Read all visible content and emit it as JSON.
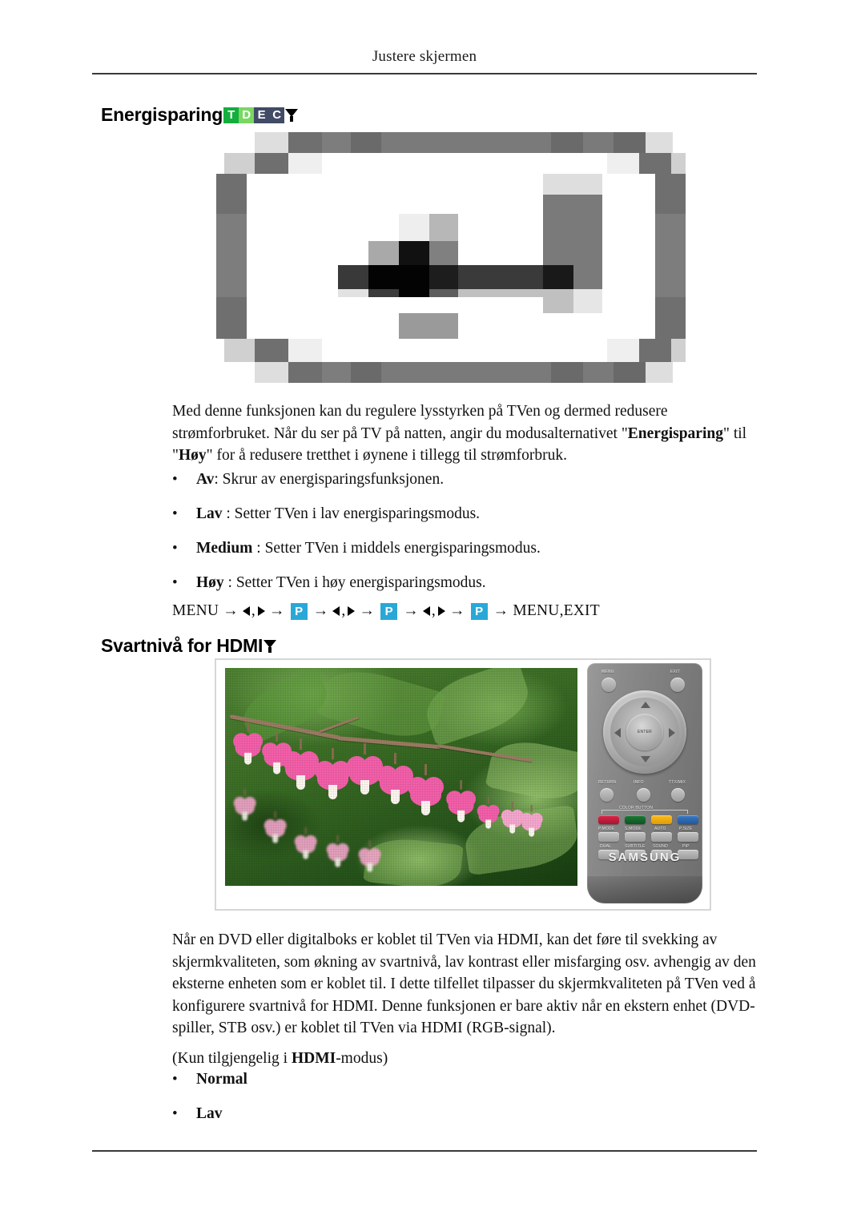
{
  "header": {
    "running_title": "Justere skjermen"
  },
  "sections": {
    "energisparing": {
      "heading": "Energisparing",
      "badges": [
        {
          "letter": "T",
          "color": "#14ae3c"
        },
        {
          "letter": "D",
          "color": "#79d763"
        },
        {
          "letter": "E",
          "color": "#414b66"
        },
        {
          "letter": "C",
          "color": "#414b66"
        }
      ],
      "filter_icon": "funnel-icon",
      "figure_alt": "energisparing-osd-screenshot",
      "paragraph_1": "Med denne funksjonen kan du regulere lysstyrken på TVen og dermed redusere strømforbruket. Når du ser på TV på natten, angir du modusalternativet \"",
      "paragraph_bold_1": "Energisparing",
      "paragraph_2": "\" til \"",
      "paragraph_bold_2": "Høy",
      "paragraph_3": "\" for å redusere tretthet i øynene i tillegg til strømforbruk.",
      "bullets": [
        {
          "term": "Av",
          "rest": ": Skrur av energisparingsfunksjonen."
        },
        {
          "term": "Lav",
          "rest": " : Setter TVen i lav energisparingsmodus."
        },
        {
          "term": "Medium",
          "rest": " : Setter TVen i middels energisparingsmodus."
        },
        {
          "term": "Høy",
          "rest": " : Setter TVen i høy energisparingsmodus."
        }
      ],
      "nav": {
        "start": "MENU",
        "end": "MENU,EXIT",
        "button_label": "P",
        "button_color": "#29a8d8",
        "comma": ","
      }
    },
    "svartniva": {
      "heading": "Svartnivå for HDMI",
      "filter_icon": "funnel-icon",
      "figure_alt": "bleeding-heart-flowers-photo-with-samsung-remote",
      "paragraph": "Når en DVD eller digitalboks er koblet til TVen via HDMI, kan det føre til svekking av skjermkvaliteten, som økning av svartnivå, lav kontrast eller misfarging osv. avhengig av den eksterne enheten som er koblet til. I dette tilfellet tilpasser du skjermkvaliteten på TVen ved å konfigurere svartnivå for HDMI. Denne funksjonen er bare aktiv når en ekstern enhet (DVD-spiller, STB osv.) er koblet til TVen via HDMI (RGB-signal).",
      "note_prefix": "(Kun tilgjengelig i ",
      "note_bold": "HDMI",
      "note_suffix": "-modus)",
      "bullets": [
        {
          "term": "Normal",
          "rest": ""
        },
        {
          "term": "Lav",
          "rest": ""
        }
      ]
    }
  },
  "remote": {
    "brand": "SAMSUNG",
    "top_left_label": "MENU",
    "top_right_label": "EXIT",
    "enter_label": "ENTER",
    "row_labels": [
      "RETURN",
      "INFO",
      "TTX/MIX"
    ],
    "color_button_title": "COLOR BUTTON",
    "color_buttons": [
      {
        "name": "red",
        "color": "#c21f3f"
      },
      {
        "name": "green",
        "color": "#156229"
      },
      {
        "name": "yellow",
        "color": "#f0ab10"
      },
      {
        "name": "blue",
        "color": "#2f67b0"
      }
    ],
    "function_row_1": [
      "P.MODE",
      "S.MODE",
      "AUTO",
      "P.SIZE"
    ],
    "function_row_2": [
      "DUAL",
      "SUBTITLE",
      "SOUND",
      "PIP"
    ]
  }
}
